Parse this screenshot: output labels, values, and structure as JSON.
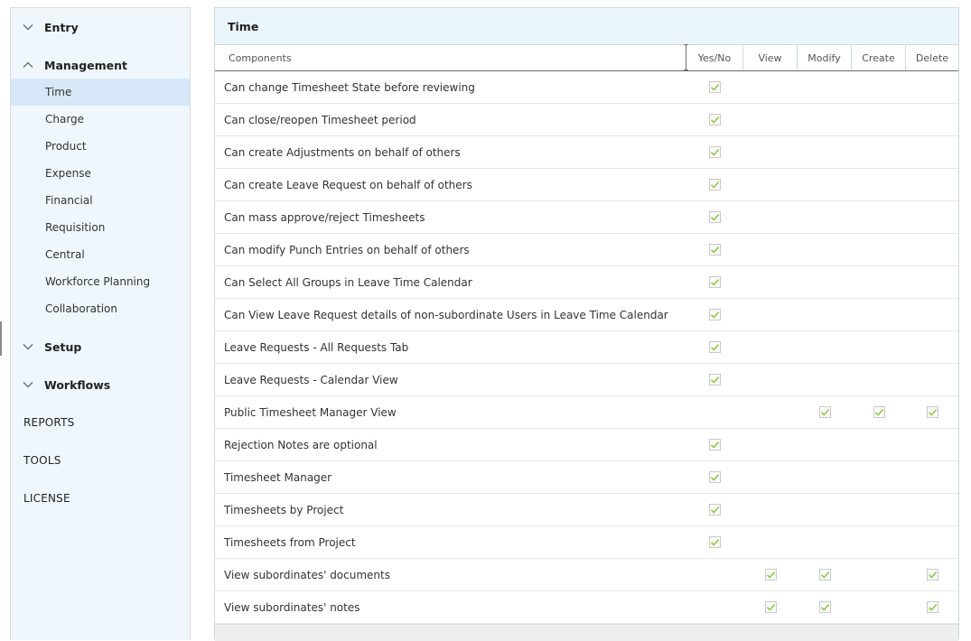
{
  "sidebar": {
    "sections": [
      {
        "label": "Entry",
        "expanded": false
      },
      {
        "label": "Management",
        "expanded": true
      },
      {
        "label": "Setup",
        "expanded": false
      },
      {
        "label": "Workflows",
        "expanded": false
      }
    ],
    "management_items": [
      "Time",
      "Charge",
      "Product",
      "Expense",
      "Financial",
      "Requisition",
      "Central",
      "Workforce Planning",
      "Collaboration"
    ],
    "selected_item": "Time",
    "links": [
      "REPORTS",
      "TOOLS",
      "LICENSE"
    ]
  },
  "panel": {
    "title": "Time",
    "columns": [
      "Components",
      "Yes/No",
      "View",
      "Modify",
      "Create",
      "Delete"
    ],
    "rows": [
      {
        "component": "Can change Timesheet State before reviewing",
        "yes_no": true,
        "view": false,
        "modify": false,
        "create": false,
        "delete": false
      },
      {
        "component": "Can close/reopen Timesheet period",
        "yes_no": true,
        "view": false,
        "modify": false,
        "create": false,
        "delete": false
      },
      {
        "component": "Can create Adjustments on behalf of others",
        "yes_no": true,
        "view": false,
        "modify": false,
        "create": false,
        "delete": false
      },
      {
        "component": "Can create Leave Request on behalf of others",
        "yes_no": true,
        "view": false,
        "modify": false,
        "create": false,
        "delete": false
      },
      {
        "component": "Can mass approve/reject Timesheets",
        "yes_no": true,
        "view": false,
        "modify": false,
        "create": false,
        "delete": false
      },
      {
        "component": "Can modify Punch Entries on behalf of others",
        "yes_no": true,
        "view": false,
        "modify": false,
        "create": false,
        "delete": false
      },
      {
        "component": "Can Select All Groups in Leave Time Calendar",
        "yes_no": true,
        "view": false,
        "modify": false,
        "create": false,
        "delete": false
      },
      {
        "component": "Can View Leave Request details of non-subordinate Users in Leave Time Calendar",
        "yes_no": true,
        "view": false,
        "modify": false,
        "create": false,
        "delete": false
      },
      {
        "component": "Leave Requests - All Requests Tab",
        "yes_no": true,
        "view": false,
        "modify": false,
        "create": false,
        "delete": false
      },
      {
        "component": "Leave Requests - Calendar View",
        "yes_no": true,
        "view": false,
        "modify": false,
        "create": false,
        "delete": false
      },
      {
        "component": "Public Timesheet Manager View",
        "yes_no": false,
        "view": false,
        "modify": true,
        "create": true,
        "delete": true
      },
      {
        "component": "Rejection Notes are optional",
        "yes_no": true,
        "view": false,
        "modify": false,
        "create": false,
        "delete": false
      },
      {
        "component": "Timesheet Manager",
        "yes_no": true,
        "view": false,
        "modify": false,
        "create": false,
        "delete": false
      },
      {
        "component": "Timesheets by Project",
        "yes_no": true,
        "view": false,
        "modify": false,
        "create": false,
        "delete": false
      },
      {
        "component": "Timesheets from Project",
        "yes_no": true,
        "view": false,
        "modify": false,
        "create": false,
        "delete": false
      },
      {
        "component": "View subordinates' documents",
        "yes_no": false,
        "view": true,
        "modify": true,
        "create": false,
        "delete": true
      },
      {
        "component": "View subordinates' notes",
        "yes_no": false,
        "view": true,
        "modify": true,
        "create": false,
        "delete": true
      }
    ]
  },
  "colors": {
    "sidebar_bg": "#f0f7fc",
    "selected_bg": "#d6e8f7",
    "title_bg": "#eaf4fb",
    "check_green": "#8cc63f"
  },
  "icons": {
    "collapsed": "chevron-down-icon",
    "expanded": "chevron-up-icon",
    "check": "check-icon"
  }
}
